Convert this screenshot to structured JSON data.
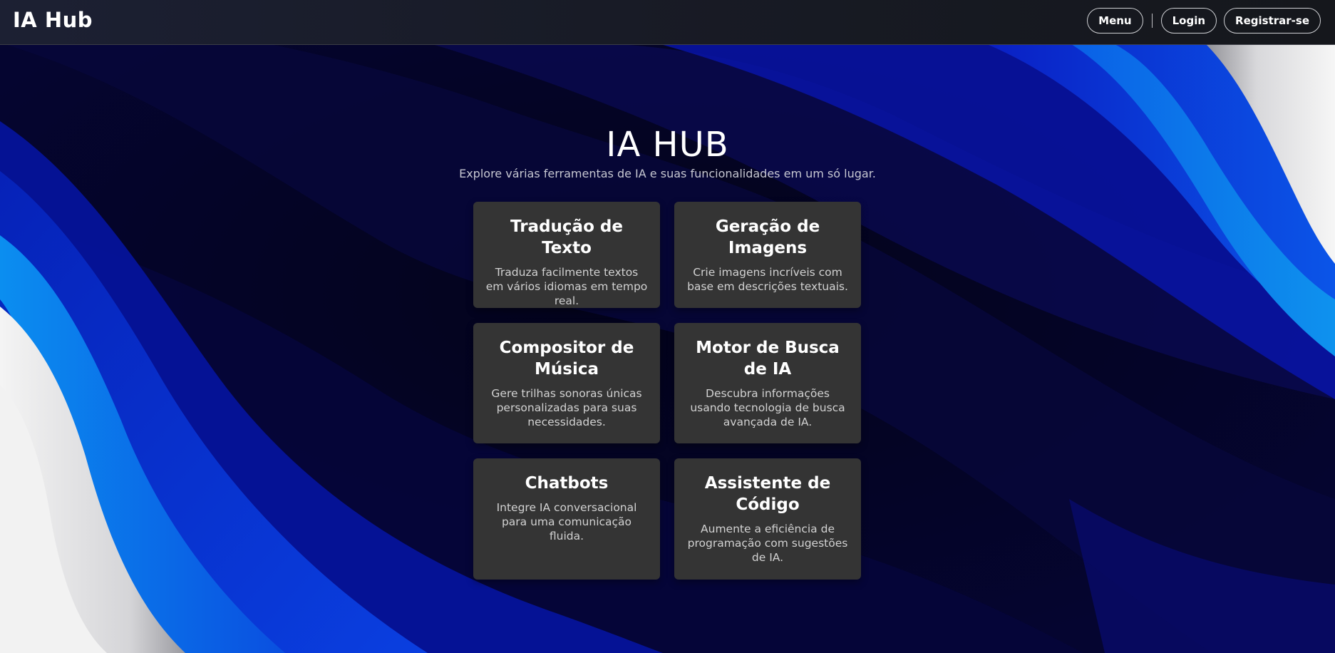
{
  "header": {
    "logo": "IA Hub",
    "menu_label": "Menu",
    "login_label": "Login",
    "register_label": "Registrar-se"
  },
  "hero": {
    "title": "IA HUB",
    "subtitle": "Explore várias ferramentas de IA e suas funcionalidades em um só lugar."
  },
  "cards": [
    {
      "title": "Tradução de Texto",
      "description": "Traduza facilmente textos em vários idiomas em tempo real."
    },
    {
      "title": "Geração de Imagens",
      "description": "Crie imagens incríveis com base em descrições textuais."
    },
    {
      "title": "Compositor de Música",
      "description": "Gere trilhas sonoras únicas personalizadas para suas necessidades."
    },
    {
      "title": "Motor de Busca de IA",
      "description": "Descubra informações usando tecnologia de busca avançada de IA."
    },
    {
      "title": "Chatbots",
      "description": "Integre IA conversacional para uma comunicação fluida."
    },
    {
      "title": "Assistente de Código",
      "description": "Aumente a eficiência de programação com sugestões de IA."
    }
  ],
  "colors": {
    "card_background": "#343434",
    "navbar_background": "#181b26",
    "wave_blue": "#0a37d6",
    "wave_light_blue": "#0b7ae0",
    "wave_silver": "#d9d9d9"
  }
}
